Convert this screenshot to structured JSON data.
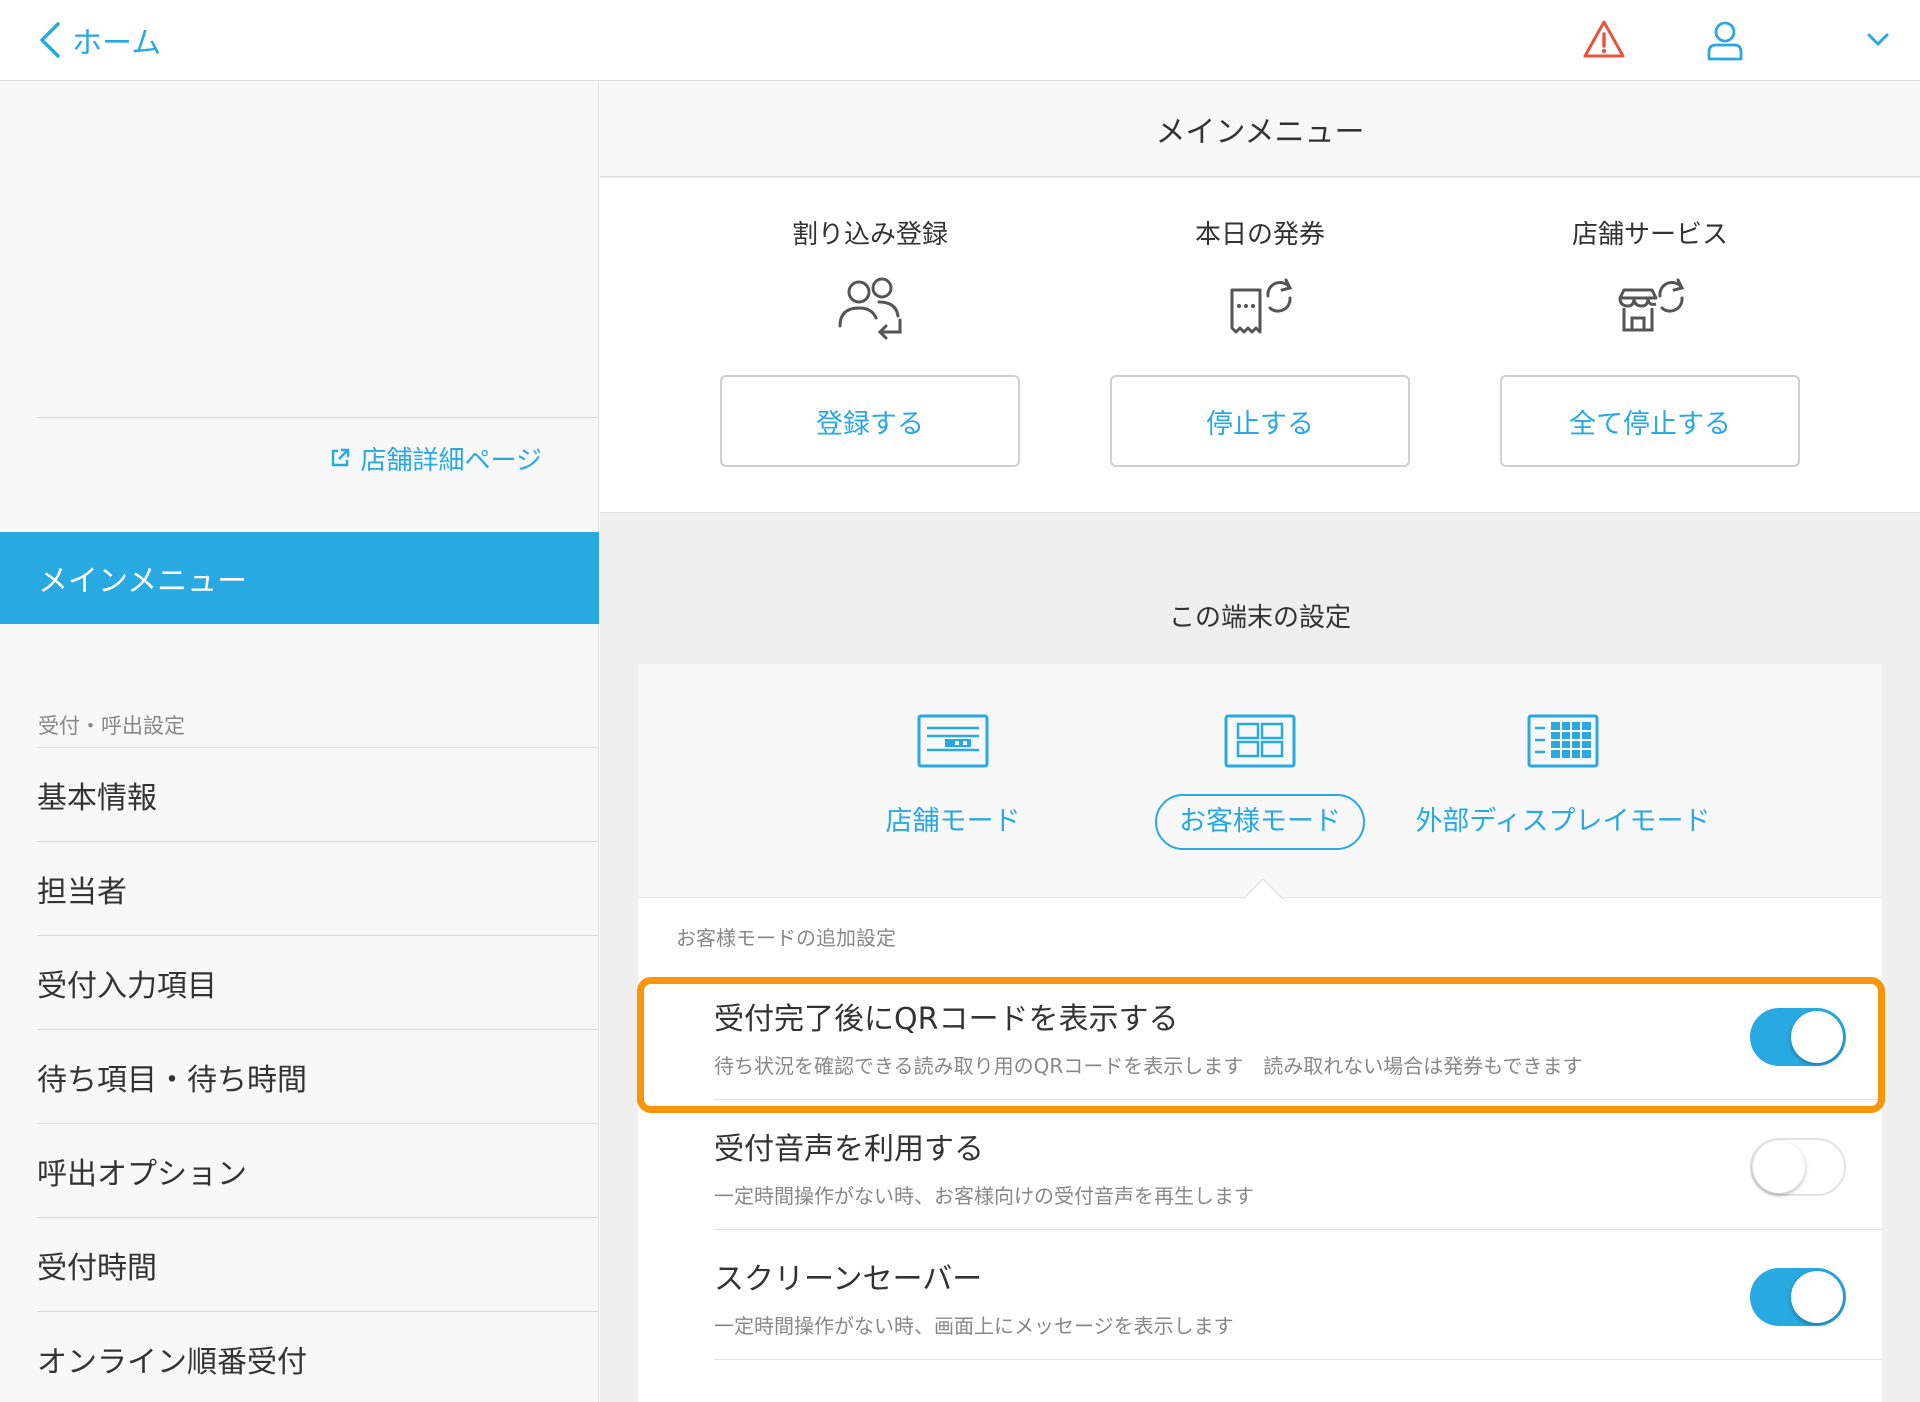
{
  "topbar": {
    "back_label": "ホーム",
    "icons": [
      "alert-icon",
      "user-icon",
      "chevron-down-icon"
    ],
    "alert_color": "#e9533d",
    "accent_color": "#29a9e1"
  },
  "sidebar": {
    "shop_link": "店舗詳細ページ",
    "active_item": "メインメニュー",
    "section_label": "受付・呼出設定",
    "items": [
      {
        "label": "基本情報"
      },
      {
        "label": "担当者"
      },
      {
        "label": "受付入力項目"
      },
      {
        "label": "待ち項目・待ち時間"
      },
      {
        "label": "呼出オプション"
      },
      {
        "label": "受付時間"
      },
      {
        "label": "オンライン順番受付"
      }
    ]
  },
  "main": {
    "title": "メインメニュー",
    "actions": [
      {
        "label": "割り込み登録",
        "button": "登録する",
        "icon": "people-interrupt-icon"
      },
      {
        "label": "本日の発券",
        "button": "停止する",
        "icon": "ticket-refresh-icon"
      },
      {
        "label": "店舗サービス",
        "button": "全て停止する",
        "icon": "store-refresh-icon"
      }
    ],
    "device_title": "この端末の設定",
    "modes": [
      {
        "label": "店舗モード",
        "icon": "store-mode-icon",
        "selected": false
      },
      {
        "label": "お客様モード",
        "icon": "customer-mode-icon",
        "selected": true
      },
      {
        "label": "外部ディスプレイモード",
        "icon": "display-mode-icon",
        "selected": false
      }
    ],
    "additional_label": "お客様モードの追加設定",
    "settings": [
      {
        "title": "受付完了後にQRコードを表示する",
        "description": "待ち状況を確認できる読み取り用のQRコードを表示します　読み取れない場合は発券もできます",
        "enabled": true,
        "highlighted": true
      },
      {
        "title": "受付音声を利用する",
        "description": "一定時間操作がない時、お客様向けの受付音声を再生します",
        "enabled": false,
        "highlighted": false
      },
      {
        "title": "スクリーンセーバー",
        "description": "一定時間操作がない時、画面上にメッセージを表示します",
        "enabled": true,
        "highlighted": false
      }
    ],
    "highlight_color": "#f7960a"
  }
}
